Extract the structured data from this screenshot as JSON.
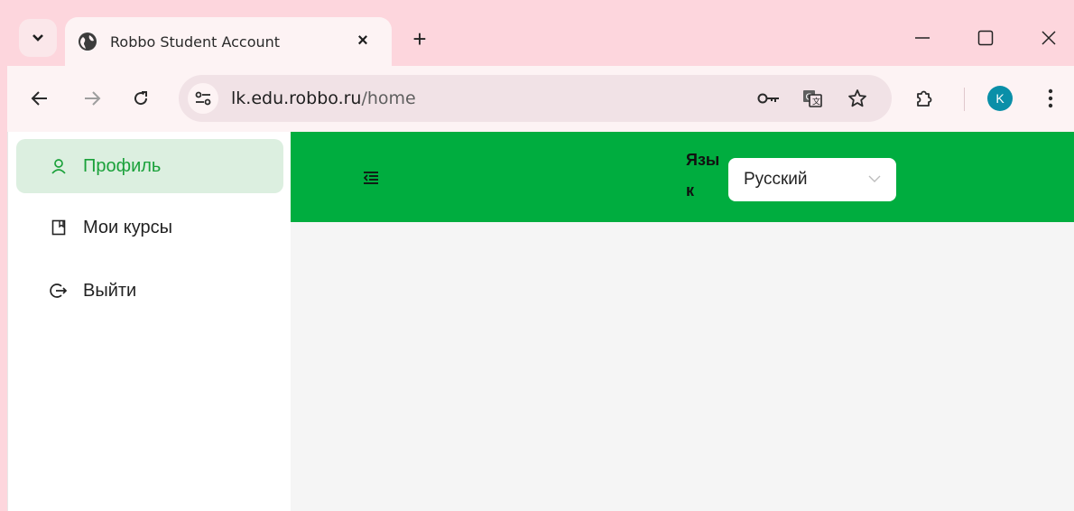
{
  "browser": {
    "tab_title": "Robbo Student Account",
    "tab_close": "×",
    "new_tab": "+",
    "url_host": "lk.edu.robbo.ru",
    "url_path": "/home",
    "profile_initial": "K"
  },
  "sidebar": {
    "items": [
      {
        "label": "Профиль",
        "icon": "user-icon",
        "active": true
      },
      {
        "label": "Мои курсы",
        "icon": "book-icon",
        "active": false
      },
      {
        "label": "Выйти",
        "icon": "logout-icon",
        "active": false
      }
    ]
  },
  "header": {
    "language_label": "Язык",
    "language_value": "Русский"
  },
  "colors": {
    "header_green": "#00ad3f",
    "active_item_bg": "#dcefe0",
    "active_item_text": "#1aa13a",
    "chrome_pink": "#fdd6dd"
  }
}
